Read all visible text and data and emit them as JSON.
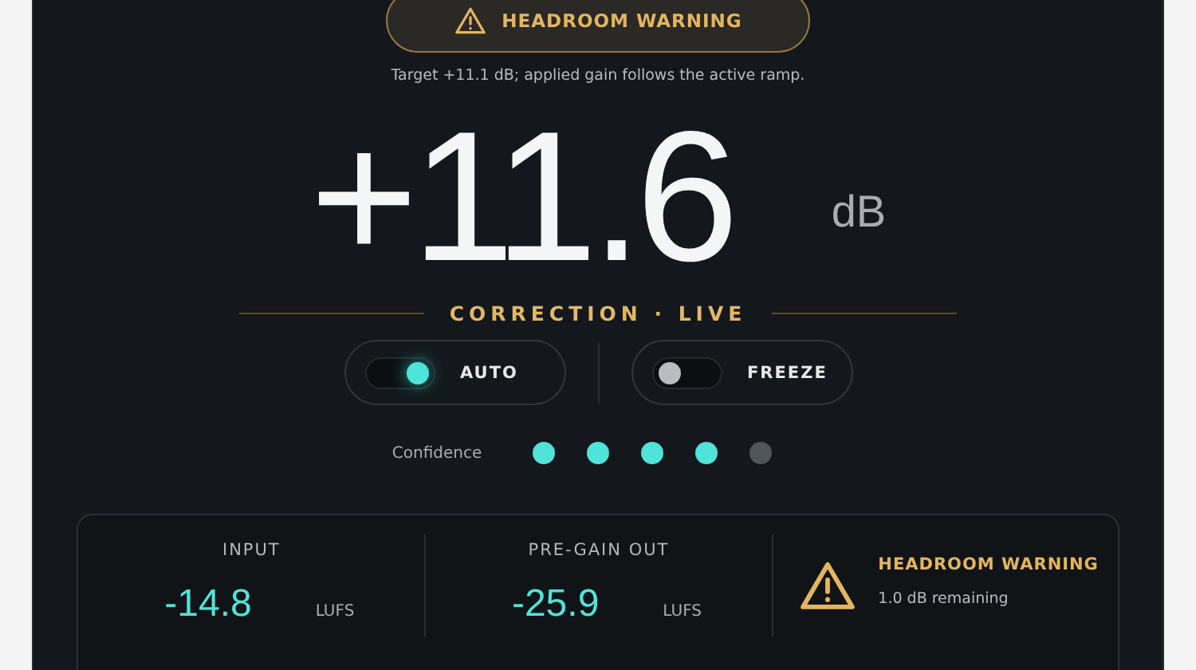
{
  "warning_banner": {
    "label": "HEADROOM WARNING"
  },
  "caption": "Target +11.1 dB; applied gain follows the active ramp.",
  "correction": {
    "value": "+11.6",
    "unit": "dB",
    "status": "CORRECTION · LIVE"
  },
  "toggles": [
    {
      "label": "AUTO",
      "on": true
    },
    {
      "label": "FREEZE",
      "on": false
    }
  ],
  "confidence": {
    "label": "Confidence",
    "dots": [
      {
        "on": true
      },
      {
        "on": true
      },
      {
        "on": true
      },
      {
        "on": true
      },
      {
        "on": false
      }
    ]
  },
  "meters": [
    {
      "kind": "reading",
      "label": "INPUT",
      "value": "-14.8",
      "unit": "LUFS"
    },
    {
      "kind": "reading",
      "label": "PRE-GAIN OUT",
      "value": "-25.9",
      "unit": "LUFS"
    },
    {
      "kind": "warning",
      "label": "HEADROOM WARNING",
      "detail": "1.0 dB remaining"
    }
  ]
}
